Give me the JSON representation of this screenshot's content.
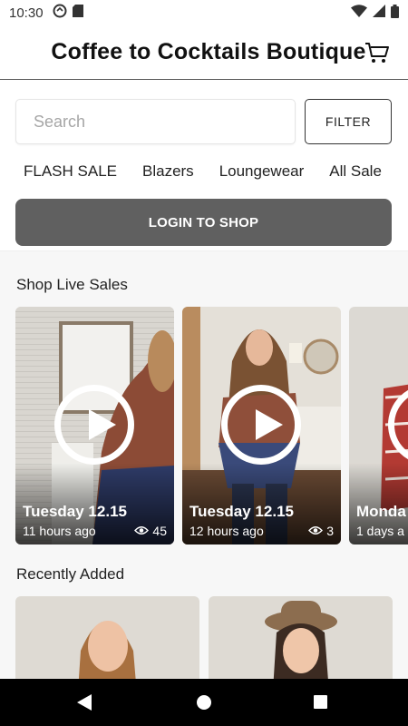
{
  "status_bar": {
    "time": "10:30"
  },
  "header": {
    "title": "Coffee to Cocktails Boutique"
  },
  "search": {
    "placeholder": "Search",
    "value": ""
  },
  "filter_label": "FILTER",
  "categories": [
    "FLASH SALE",
    "Blazers",
    "Loungewear",
    "All Sale"
  ],
  "login_label": "LOGIN TO SHOP",
  "live_sales": {
    "title": "Shop Live Sales",
    "items": [
      {
        "date": "Tuesday 12.15",
        "time": "11 hours ago",
        "views": "45"
      },
      {
        "date": "Tuesday 12.15",
        "time": "12 hours ago",
        "views": "3"
      },
      {
        "date": "Monda",
        "time": "1 days a",
        "views": ""
      }
    ]
  },
  "recently_added": {
    "title": "Recently Added"
  },
  "icons": [
    "cart-icon",
    "play-icon",
    "eye-icon",
    "wifi-icon",
    "signal-icon",
    "battery-icon",
    "back-icon",
    "home-icon",
    "recents-icon"
  ],
  "colors": {
    "login_bg": "#606060",
    "accent_text": "#222222",
    "nav_bg": "#000000"
  }
}
